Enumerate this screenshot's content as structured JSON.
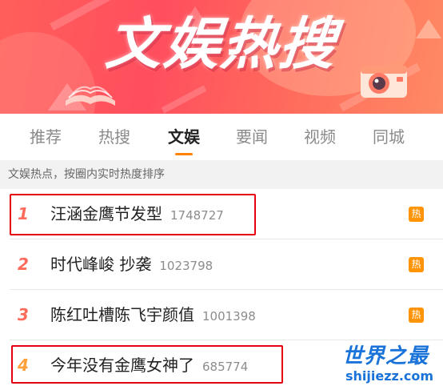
{
  "banner": {
    "title": "文娱热搜",
    "decor_icons": [
      "camera-icon",
      "book-icon"
    ]
  },
  "tabs": [
    {
      "label": "推荐",
      "active": false
    },
    {
      "label": "热搜",
      "active": false
    },
    {
      "label": "文娱",
      "active": true
    },
    {
      "label": "要闻",
      "active": false
    },
    {
      "label": "视频",
      "active": false
    },
    {
      "label": "同城",
      "active": false
    }
  ],
  "subtitle": "文娱热点，按圈内实时热度排序",
  "list": [
    {
      "rank": "1",
      "title": "汪涵金鹰节发型",
      "count": "1748727",
      "badge": "热",
      "rank_color": "#ff6b5a",
      "highlighted": true
    },
    {
      "rank": "2",
      "title": "时代峰峻 抄袭",
      "count": "1023798",
      "badge": "热",
      "rank_color": "#ff6b5a",
      "highlighted": false
    },
    {
      "rank": "3",
      "title": "陈红吐槽陈飞宇颜值",
      "count": "1001398",
      "badge": "热",
      "rank_color": "#ff6b5a",
      "highlighted": false
    },
    {
      "rank": "4",
      "title": "今年没有金鹰女神了",
      "count": "685774",
      "badge": "",
      "rank_color": "#ffa03a",
      "highlighted": true
    }
  ],
  "colors": {
    "accent_orange": "#ff8200",
    "hot_badge": "#ff9406",
    "highlight_red": "#e60012",
    "watermark_blue": "#1a73d9"
  },
  "watermark": {
    "title": "世界之最",
    "url": "shijiezz.com"
  }
}
